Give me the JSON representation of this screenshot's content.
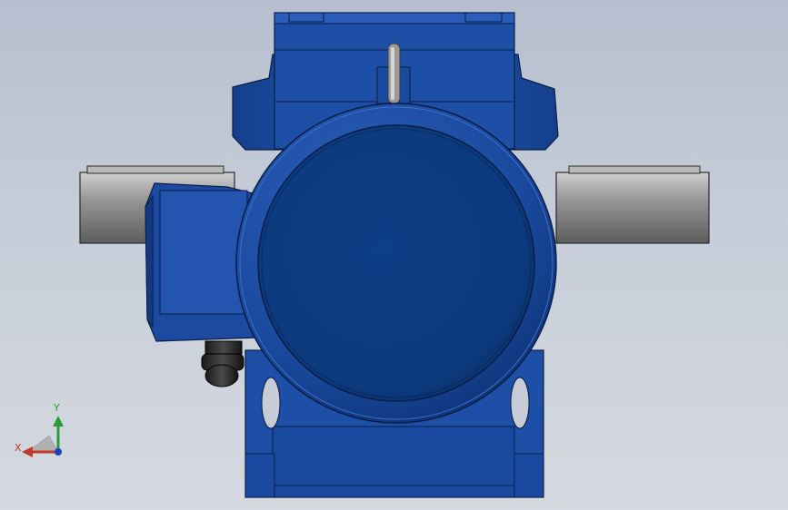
{
  "viewport": {
    "background_top": "#b6bfcf",
    "background_bottom": "#d5d9e0"
  },
  "model": {
    "body_color": "#1f4fa3",
    "body_dark": "#0b2c6e",
    "shaft_color": "#8a8a8a",
    "cover_color": "#0d3f86"
  },
  "triad": {
    "x_label": "X",
    "y_label": "Y",
    "x_color": "#c0392b",
    "y_color": "#2e9a3c"
  }
}
